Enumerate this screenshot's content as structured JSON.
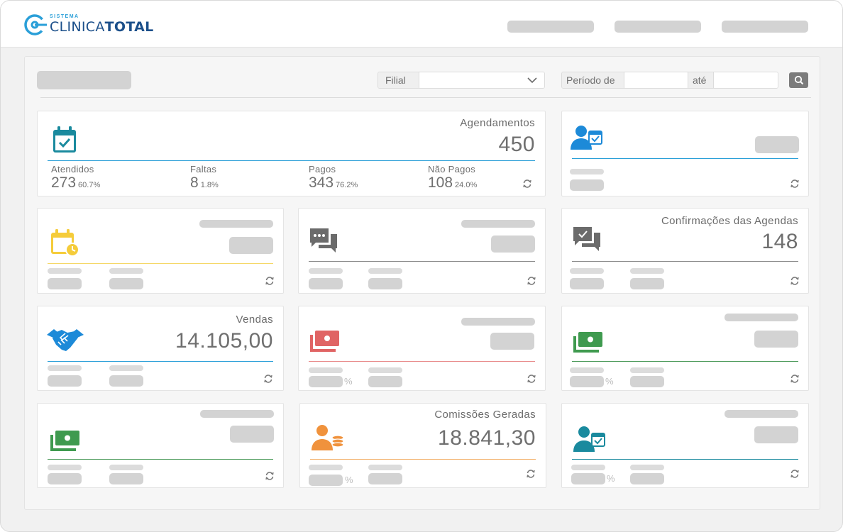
{
  "brand": {
    "small": "SISTEMA",
    "name_light": "CLINICA",
    "name_bold": "TOTAL"
  },
  "filters": {
    "filial_label": "Filial",
    "periodo_label": "Período de",
    "ate_label": "até"
  },
  "cards": {
    "agendamentos": {
      "title": "Agendamentos",
      "value": "450",
      "stats": [
        {
          "label": "Atendidos",
          "value": "273",
          "pct": "60.7%"
        },
        {
          "label": "Faltas",
          "value": "8",
          "pct": "1.8%"
        },
        {
          "label": "Pagos",
          "value": "343",
          "pct": "76.2%"
        },
        {
          "label": "Não Pagos",
          "value": "108",
          "pct": "24.0%"
        }
      ]
    },
    "confirmacoes": {
      "title": "Confirmações das Agendas",
      "value": "148"
    },
    "vendas": {
      "title": "Vendas",
      "value": "14.105,00"
    },
    "comissoes": {
      "title": "Comissões Geradas",
      "value": "18.841,30"
    }
  },
  "pct_sign": "%",
  "colors": {
    "teal": "#1a8a9e",
    "blue": "#1d8ad8",
    "yellow": "#f5cc3a",
    "gray_icon": "#6b6b6b",
    "red": "#e06464",
    "green": "#3f9a4f",
    "orange": "#f0923c"
  }
}
